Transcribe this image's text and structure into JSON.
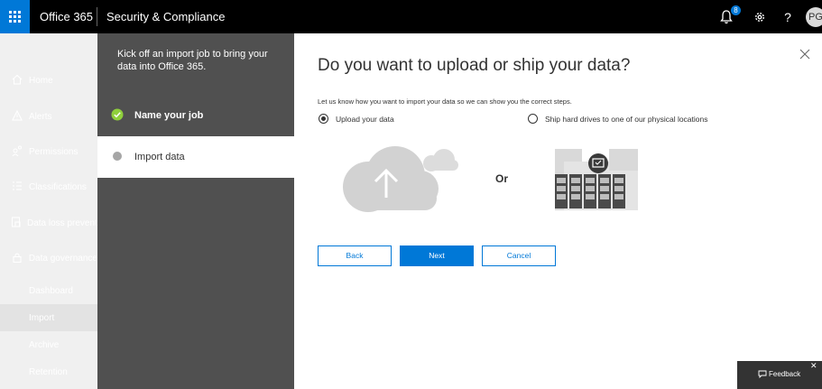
{
  "top_bar": {
    "brand": "Office 365",
    "app_title": "Security & Compliance",
    "notification_count": "8",
    "avatar_initials": "PG",
    "help_label": "?",
    "accent_color": "#0078d7"
  },
  "left_nav": {
    "items": [
      {
        "label": "Home",
        "icon": "home-icon"
      },
      {
        "label": "Alerts",
        "icon": "alert-icon"
      },
      {
        "label": "Permissions",
        "icon": "permissions-icon"
      },
      {
        "label": "Classifications",
        "icon": "classifications-icon"
      },
      {
        "label": "Data loss prevention",
        "icon": "data-loss-icon"
      },
      {
        "label": "Data governance",
        "icon": "lock-icon"
      }
    ],
    "sub_items": [
      {
        "label": "Dashboard"
      },
      {
        "label": "Import",
        "selected": true
      },
      {
        "label": "Archive"
      },
      {
        "label": "Retention"
      }
    ]
  },
  "wizard": {
    "intro": "Kick off an import job to bring your data into Office 365.",
    "steps": [
      {
        "label": "Name your job",
        "status": "complete"
      },
      {
        "label": "Import data",
        "status": "current"
      }
    ]
  },
  "main": {
    "heading": "Do you want to upload or ship your data?",
    "prompt": "Let us know how you want to import your data so we can show you the correct steps.",
    "options": [
      {
        "label": "Upload your data",
        "selected": true
      },
      {
        "label": "Ship hard drives to one of our physical locations",
        "selected": false
      }
    ],
    "or_label": "Or",
    "buttons": {
      "back": "Back",
      "next": "Next",
      "cancel": "Cancel"
    }
  },
  "feedback": {
    "label": "Feedback",
    "close": "✕"
  }
}
